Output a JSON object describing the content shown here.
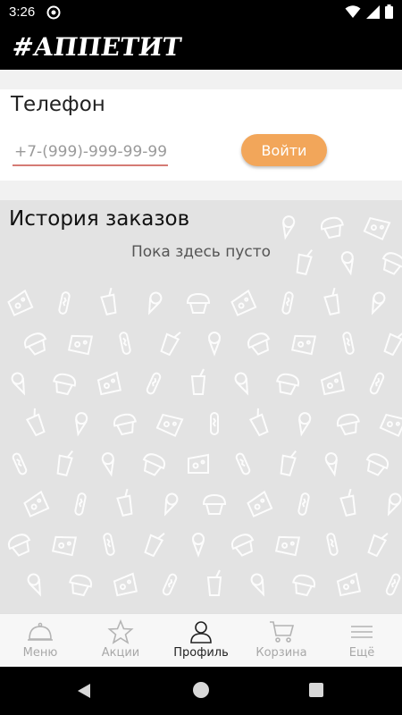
{
  "status_bar": {
    "time": "3:26",
    "icons": [
      "app-notification-icon",
      "wifi-icon",
      "cellular-signal-icon",
      "battery-icon"
    ]
  },
  "app": {
    "brand": "#АППЕТИТ"
  },
  "phone_section": {
    "title": "Телефон",
    "placeholder": "+7-(999)-999-99-99",
    "value": "",
    "login_label": "Войти"
  },
  "history": {
    "title": "История заказов",
    "empty_text": "Пока здесь пусто"
  },
  "bottom_nav": {
    "items": [
      {
        "label": "Меню",
        "icon": "cloche-icon",
        "active": false
      },
      {
        "label": "Акции",
        "icon": "star-icon",
        "active": false
      },
      {
        "label": "Профиль",
        "icon": "user-icon",
        "active": true
      },
      {
        "label": "Корзина",
        "icon": "cart-icon",
        "active": false
      },
      {
        "label": "Ещё",
        "icon": "hamburger-menu-icon",
        "active": false
      }
    ]
  },
  "colors": {
    "accent": "#f2a65a",
    "input_underline": "#d57b74",
    "history_bg": "#e3e3e3",
    "header_bg": "#000000"
  }
}
